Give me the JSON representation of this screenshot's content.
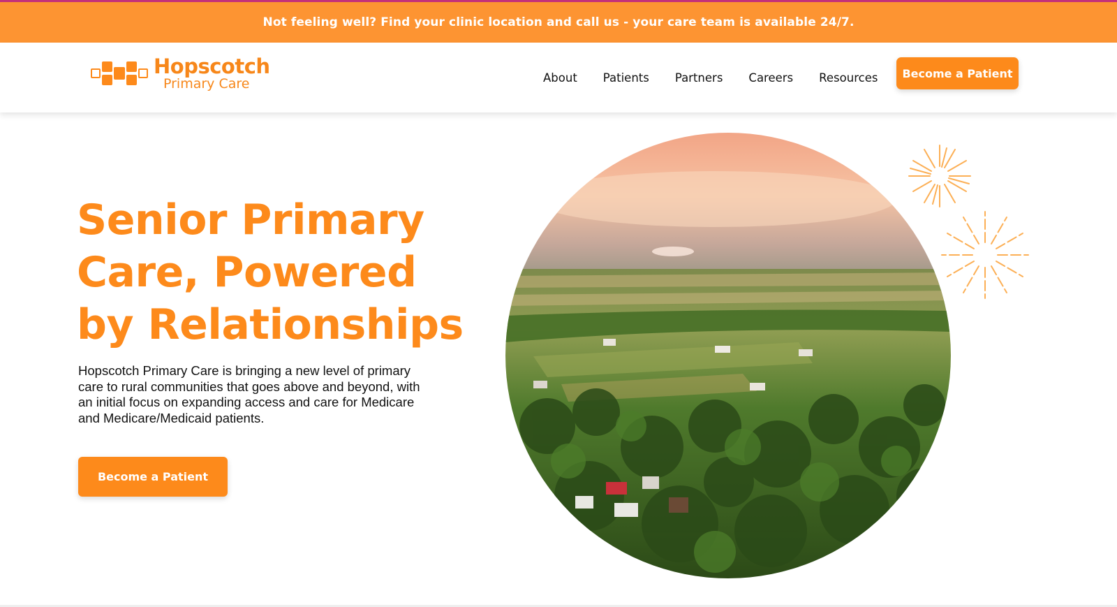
{
  "announcement": {
    "text": "Not feeling well? Find your clinic location and call us - your care team is available 24/7."
  },
  "header": {
    "logo": {
      "title": "Hopscotch",
      "subtitle": "Primary Care",
      "icon": "hopscotch-squares-icon"
    },
    "nav": [
      {
        "label": "About"
      },
      {
        "label": "Patients"
      },
      {
        "label": "Partners"
      },
      {
        "label": "Careers"
      },
      {
        "label": "Resources"
      }
    ],
    "cta_label": "Become a Patient"
  },
  "hero": {
    "title": "Senior Primary Care, Powered by Relationships",
    "body": "Hopscotch Primary Care is bringing a new level of primary care to rural communities that goes above and beyond, with an initial focus on expanding access and care for Medicare and Medicare/Medicaid patients.",
    "cta_label": "Become a Patient",
    "image": "rural-village-aerial-photo",
    "decorations": [
      "sunburst-icon",
      "sunburst-icon"
    ]
  },
  "colors": {
    "brand_orange": "#fd8a1b",
    "banner_orange": "#fd9432",
    "accent_magenta": "#c4307a",
    "text_dark": "#111111"
  }
}
